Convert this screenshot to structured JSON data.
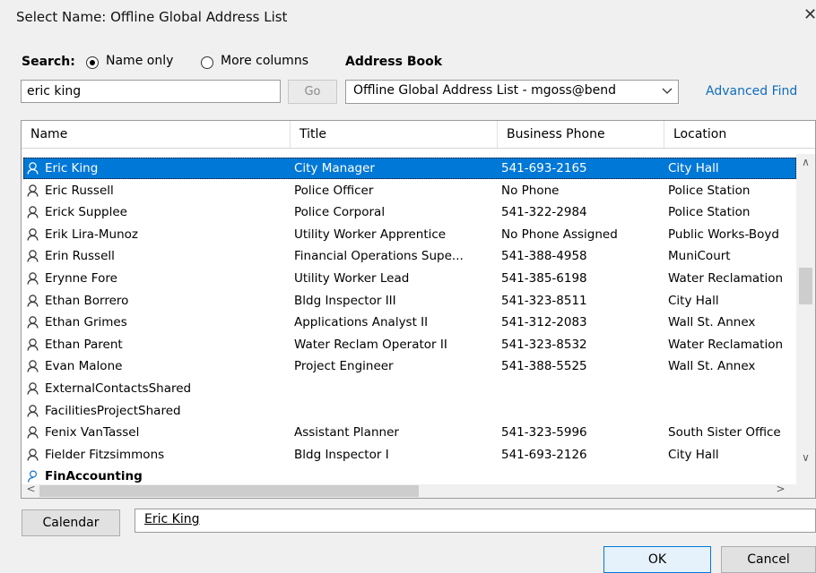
{
  "dialog": {
    "title": "Select Name: Offline Global Address List",
    "close_glyph": "✕"
  },
  "search": {
    "label": "Search:",
    "option_name_only": "Name only",
    "option_more_columns": "More columns",
    "selected_option": "Name only",
    "query": "eric king",
    "go_label": "Go"
  },
  "address_book": {
    "label": "Address Book",
    "selected": "Offline Global Address List - mgoss@bend",
    "advanced_find": "Advanced Find"
  },
  "list": {
    "columns": [
      "Name",
      "Title",
      "Business Phone",
      "Location"
    ],
    "selected_index": 0,
    "rows": [
      {
        "name": "Eric King",
        "title": "City Manager",
        "phone": "541-693-2165",
        "location": "City Hall"
      },
      {
        "name": "Eric Russell",
        "title": "Police Officer",
        "phone": "No Phone",
        "location": "Police Station"
      },
      {
        "name": "Erick Supplee",
        "title": "Police Corporal",
        "phone": "541-322-2984",
        "location": "Police Station"
      },
      {
        "name": "Erik Lira-Munoz",
        "title": "Utility Worker Apprentice",
        "phone": "No Phone Assigned",
        "location": "Public Works-Boyd"
      },
      {
        "name": "Erin Russell",
        "title": "Financial Operations Supe...",
        "phone": "541-388-4958",
        "location": "MuniCourt"
      },
      {
        "name": "Erynne Fore",
        "title": "Utility Worker Lead",
        "phone": "541-385-6198",
        "location": "Water Reclamation"
      },
      {
        "name": "Ethan Borrero",
        "title": "Bldg Inspector III",
        "phone": "541-323-8511",
        "location": "City Hall"
      },
      {
        "name": "Ethan Grimes",
        "title": "Applications Analyst II",
        "phone": "541-312-2083",
        "location": "Wall St. Annex"
      },
      {
        "name": "Ethan Parent",
        "title": "Water Reclam Operator II",
        "phone": "541-323-8532",
        "location": "Water Reclamation"
      },
      {
        "name": "Evan Malone",
        "title": "Project Engineer",
        "phone": "541-388-5525",
        "location": "Wall St. Annex"
      },
      {
        "name": "ExternalContactsShared",
        "title": "",
        "phone": "",
        "location": ""
      },
      {
        "name": "FacilitiesProjectShared",
        "title": "",
        "phone": "",
        "location": ""
      },
      {
        "name": "Fenix VanTassel",
        "title": "Assistant Planner",
        "phone": "541-323-5996",
        "location": "South Sister Office"
      },
      {
        "name": "Fielder Fitzsimmons",
        "title": "Bldg Inspector I",
        "phone": "541-693-2126",
        "location": "City Hall"
      },
      {
        "name": "FinAccounting",
        "title": "",
        "phone": "",
        "location": "",
        "group": true
      }
    ]
  },
  "calendar": {
    "button_label": "Calendar",
    "value": "Eric King"
  },
  "buttons": {
    "ok": "OK",
    "cancel": "Cancel"
  },
  "scroll": {
    "up_glyph": "∧",
    "down_glyph": "∨",
    "left_glyph": "<",
    "right_glyph": ">"
  },
  "colors": {
    "selection": "#0078d7",
    "link": "#0f6cbd"
  }
}
